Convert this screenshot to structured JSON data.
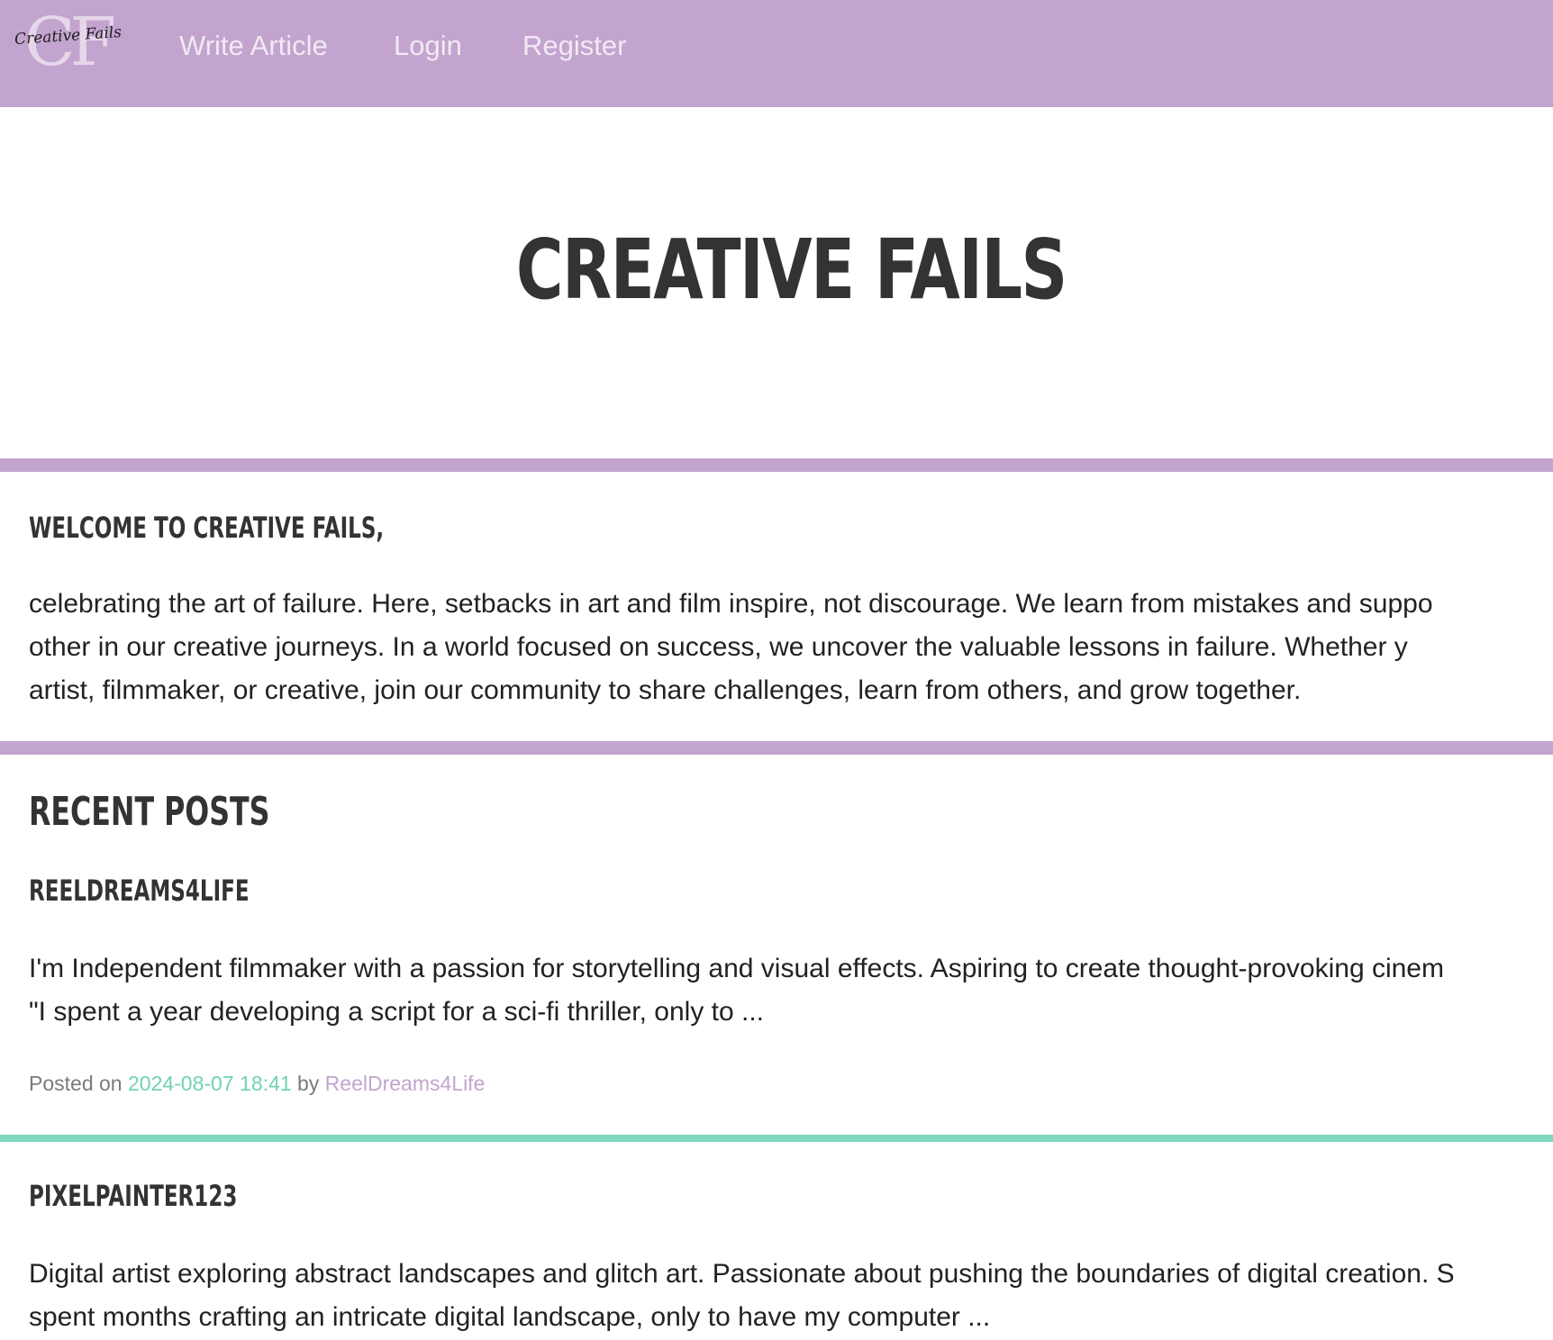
{
  "colors": {
    "brand_purple": "#c3a4cf",
    "accent_teal": "#7fd7bd",
    "heading": "#333333",
    "text": "#222222",
    "meta": "#7a7a7a"
  },
  "navbar": {
    "logo_monogram": "CF",
    "logo_script": "Creative Fails",
    "links": [
      {
        "label": "Write Article"
      },
      {
        "label": "Login"
      },
      {
        "label": "Register"
      }
    ]
  },
  "hero": {
    "title": "CREATIVE FAILS"
  },
  "welcome": {
    "heading": "WELCOME TO CREATIVE FAILS,",
    "lines": [
      "celebrating the art of failure. Here, setbacks in art and film inspire, not discourage. We learn from mistakes and suppo",
      "other in our creative journeys. In a world focused on success, we uncover the valuable lessons in failure. Whether y",
      "artist, filmmaker, or creative, join our community to share challenges, learn from others, and grow together."
    ]
  },
  "recent_posts": {
    "heading": "RECENT POSTS",
    "posts": [
      {
        "title": "REELDREAMS4LIFE",
        "excerpt_lines": [
          "I'm Independent filmmaker with a passion for storytelling and visual effects. Aspiring to create thought-provoking cinem",
          "\"I spent a year developing a script for a sci-fi thriller, only to ..."
        ],
        "meta_prefix": "Posted on",
        "date": "2024-08-07 18:41",
        "meta_by": "by",
        "author": "ReelDreams4Life"
      },
      {
        "title": "PIXELPAINTER123",
        "excerpt_lines": [
          "Digital artist exploring abstract landscapes and glitch art. Passionate about pushing the boundaries of digital creation. S",
          "spent months crafting an intricate digital landscape, only to have my computer ..."
        ]
      }
    ]
  }
}
